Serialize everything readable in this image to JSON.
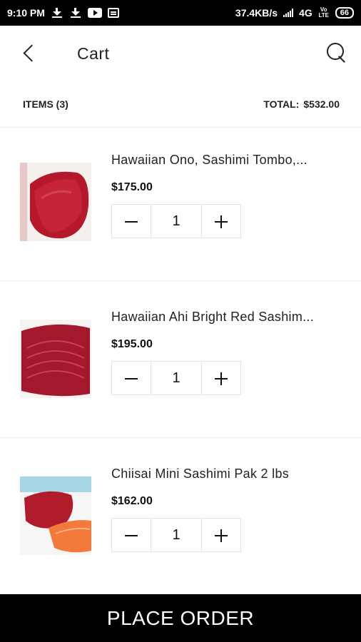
{
  "status_bar": {
    "time": "9:10 PM",
    "speed": "37.4KB/s",
    "network": "4G",
    "volte_top": "Vo",
    "volte_bottom": "LTE",
    "battery": "66",
    "icons": [
      "download-icon",
      "download-icon",
      "youtube-icon",
      "app-icon",
      "signal-icon"
    ]
  },
  "header": {
    "title": "Cart",
    "back_icon": "chevron-left-icon",
    "search_icon": "search-icon"
  },
  "summary": {
    "items_label": "ITEMS (3)",
    "total_label": "TOTAL:",
    "total_value": "$532.00"
  },
  "cart": {
    "items": [
      {
        "name": "Hawaiian Ono, Sashimi Tombo,...",
        "price": "$175.00",
        "quantity": "1",
        "image": "tuna-loin-chunk"
      },
      {
        "name": "Hawaiian Ahi Bright Red Sashim...",
        "price": "$195.00",
        "quantity": "1",
        "image": "ahi-steak"
      },
      {
        "name": "Chiisai Mini Sashimi Pak 2 lbs",
        "price": "$162.00",
        "quantity": "1",
        "image": "sashimi-pack"
      }
    ]
  },
  "footer": {
    "place_order_label": "PLACE ORDER"
  },
  "colors": {
    "status_bar_bg": "#000000",
    "button_bg": "#000000",
    "button_text": "#ffffff",
    "divider": "#ececec"
  }
}
